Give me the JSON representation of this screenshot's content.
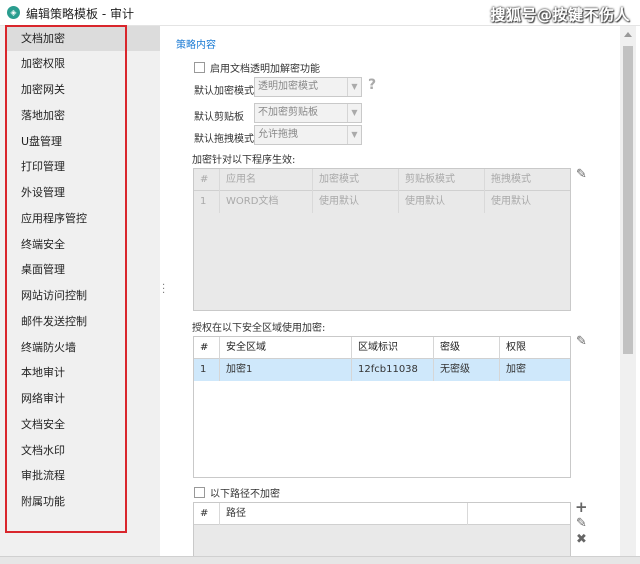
{
  "window": {
    "title": "编辑策略模板 - 审计",
    "watermark": "搜狐号@按键不伤人"
  },
  "sidebar": {
    "items": [
      {
        "label": "文档加密",
        "selected": true
      },
      {
        "label": "加密权限"
      },
      {
        "label": "加密网关"
      },
      {
        "label": "落地加密"
      },
      {
        "label": "U盘管理"
      },
      {
        "label": "打印管理"
      },
      {
        "label": "外设管理"
      },
      {
        "label": "应用程序管控"
      },
      {
        "label": "终端安全"
      },
      {
        "label": "桌面管理"
      },
      {
        "label": "网站访问控制"
      },
      {
        "label": "邮件发送控制"
      },
      {
        "label": "终端防火墙"
      },
      {
        "label": "本地审计"
      },
      {
        "label": "网络审计"
      },
      {
        "label": "文档安全"
      },
      {
        "label": "文档水印"
      },
      {
        "label": "审批流程"
      },
      {
        "label": "附属功能"
      }
    ]
  },
  "main": {
    "section_title": "策略内容",
    "enable_transparent": "启用文档透明加解密功能",
    "default_encrypt_mode": {
      "label": "默认加密模式",
      "value": "透明加密模式"
    },
    "default_clipboard": {
      "label": "默认剪贴板",
      "value": "不加密剪贴板"
    },
    "default_drag": {
      "label": "默认拖拽模式",
      "value": "允许拖拽"
    },
    "help_icon": "?",
    "program_table": {
      "label": "加密针对以下程序生效:",
      "headers": [
        "#",
        "应用名",
        "加密模式",
        "剪贴板模式",
        "拖拽模式"
      ],
      "rows": [
        [
          "1",
          "WORD文档",
          "使用默认",
          "使用默认",
          "使用默认"
        ]
      ]
    },
    "zone_table": {
      "label": "授权在以下安全区域使用加密:",
      "headers": [
        "#",
        "安全区域",
        "区域标识",
        "密级",
        "权限"
      ],
      "rows": [
        [
          "1",
          "加密1",
          "12fcb11038",
          "无密级",
          "加密"
        ]
      ]
    },
    "exclude_paths": "以下路径不加密",
    "path_table": {
      "headers": [
        "#",
        "路径"
      ]
    }
  },
  "icons": {
    "edit": "pencil-icon",
    "add": "plus-icon",
    "delete": "cross-icon"
  }
}
